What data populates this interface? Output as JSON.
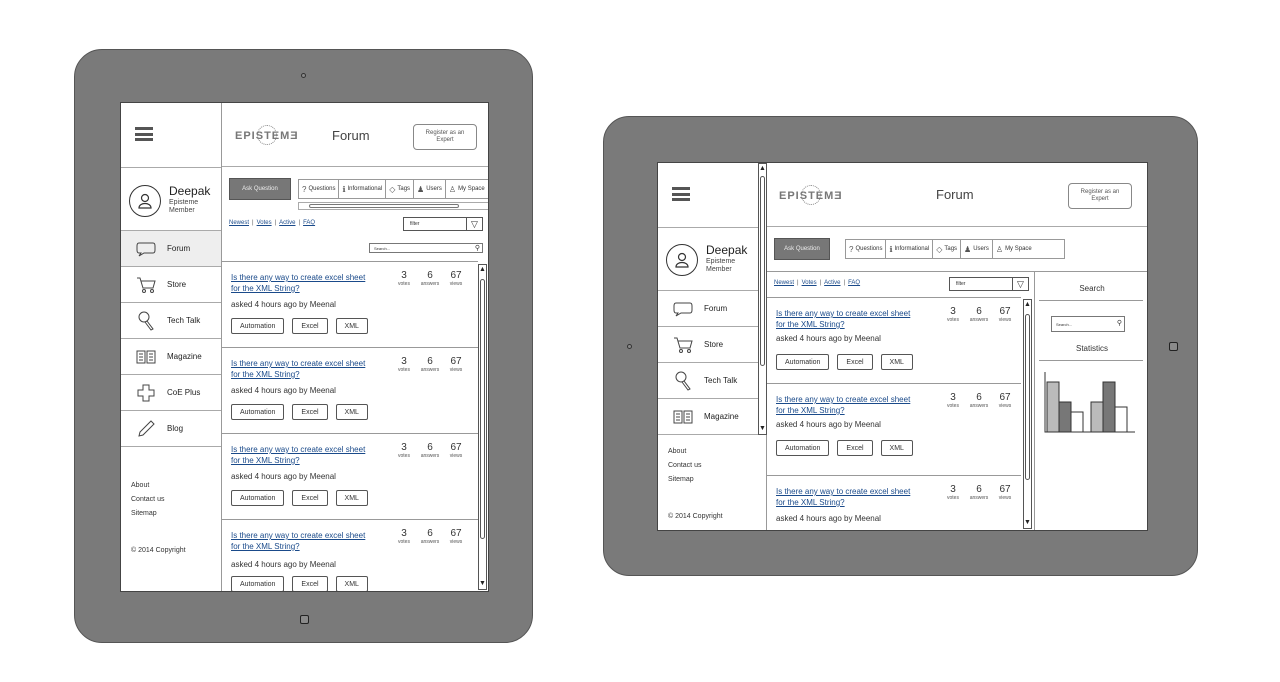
{
  "user": {
    "name": "Deepak",
    "role_line1": "Episteme",
    "role_line2": "Member"
  },
  "nav_items": [
    {
      "label": "Forum",
      "icon": "speech-bubble-icon"
    },
    {
      "label": "Store",
      "icon": "cart-icon"
    },
    {
      "label": "Tech Talk",
      "icon": "microphone-icon"
    },
    {
      "label": "Magazine",
      "icon": "book-icon"
    },
    {
      "label": "CoE Plus",
      "icon": "plus-icon"
    },
    {
      "label": "Blog",
      "icon": "pencil-icon"
    }
  ],
  "footer": {
    "about": "About",
    "contact": "Contact us",
    "sitemap": "Sitemap",
    "copyright": "© 2014 Copyright"
  },
  "header": {
    "logo": "EPISTEMƎ",
    "title": "Forum",
    "register_line1": "Register as an",
    "register_line2": "Expert"
  },
  "toolbar": {
    "ask_label": "Ask Question",
    "tabs": [
      {
        "label": "Questions",
        "icon": "?"
      },
      {
        "label": "Informational",
        "icon": "ℹ"
      },
      {
        "label": "Tags",
        "icon": "◇"
      },
      {
        "label": "Users",
        "icon": "♟"
      },
      {
        "label": "My Space",
        "icon": "♙"
      }
    ]
  },
  "filters": {
    "newest": "Newest",
    "votes": "Votes",
    "active": "Active",
    "faq": "FAQ",
    "select_value": "filter",
    "search_placeholder": "Search..."
  },
  "question": {
    "title_line1": "Is there any way to create excel sheet",
    "title_line2": "for the XML String?",
    "meta": "asked 4 hours ago by Meenal",
    "votes": "3",
    "votes_label": "votes",
    "answers": "6",
    "answers_label": "answers",
    "views": "67",
    "views_label": "views",
    "tags": [
      "Automation",
      "Excel",
      "XML"
    ]
  },
  "right_panel": {
    "search_title": "Search",
    "statistics_title": "Statistics",
    "search_placeholder": "Search..."
  },
  "stats_chart": {
    "values": [
      5,
      3,
      2,
      3,
      5,
      2.5
    ],
    "fills": [
      "#bbbbbb",
      "#777777",
      "#ffffff",
      "#bbbbbb",
      "#777777",
      "#ffffff"
    ]
  }
}
